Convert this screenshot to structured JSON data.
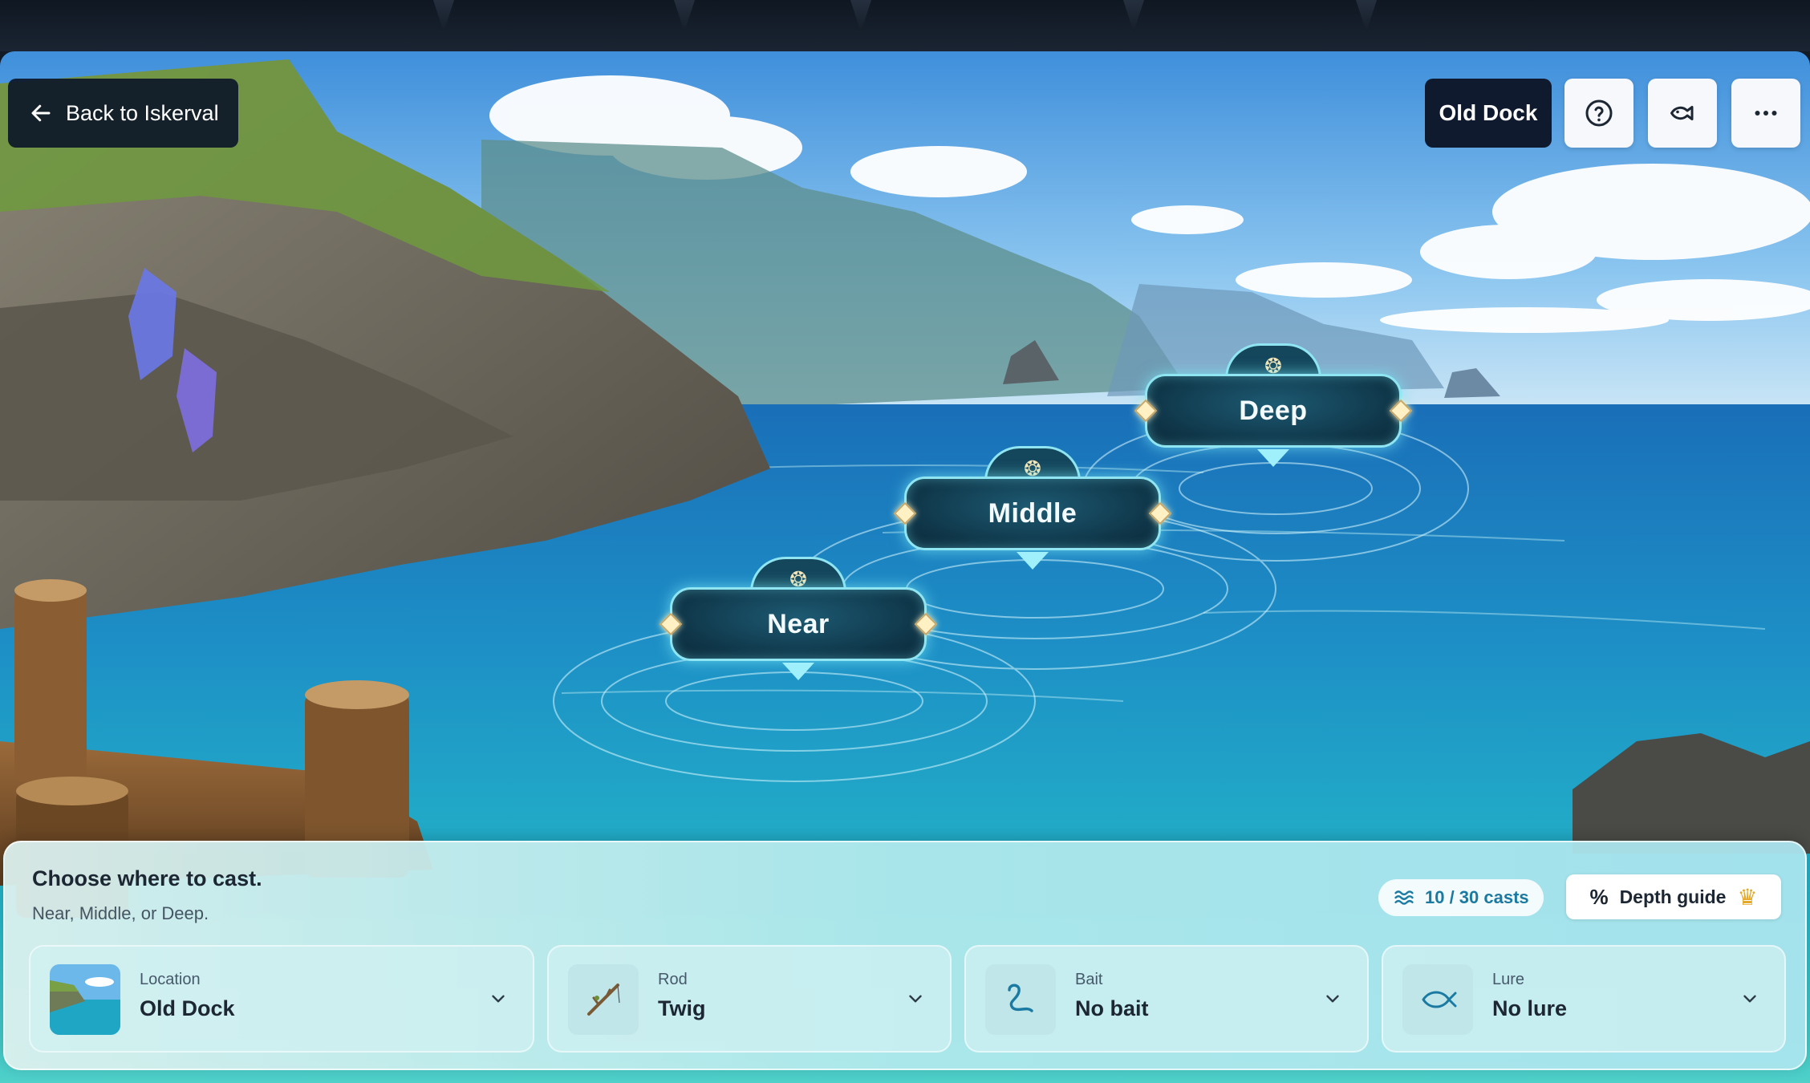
{
  "nav": {
    "back_label": "Back to Iskerval"
  },
  "header": {
    "location_badge": "Old Dock"
  },
  "toolbar": {
    "help_icon": "question-circle-icon",
    "fish_icon": "fish-icon",
    "more_icon": "more-dots-icon"
  },
  "cast_spots": [
    {
      "label": "Near"
    },
    {
      "label": "Middle"
    },
    {
      "label": "Deep"
    }
  ],
  "panel": {
    "title": "Choose where to cast.",
    "subtitle": "Near, Middle, or Deep.",
    "casts": "10 / 30 casts",
    "depth_guide": "Depth guide"
  },
  "equipment": [
    {
      "label": "Location",
      "value": "Old Dock",
      "icon": "landscape-thumbnail"
    },
    {
      "label": "Rod",
      "value": "Twig",
      "icon": "twig-rod-icon"
    },
    {
      "label": "Bait",
      "value": "No bait",
      "icon": "worm-icon"
    },
    {
      "label": "Lure",
      "value": "No lure",
      "icon": "fish-outline-icon"
    }
  ],
  "colors": {
    "spot_glow": "#8fe6f2",
    "navy": "#0f1a2e",
    "casts_text": "#1b7aa2"
  }
}
